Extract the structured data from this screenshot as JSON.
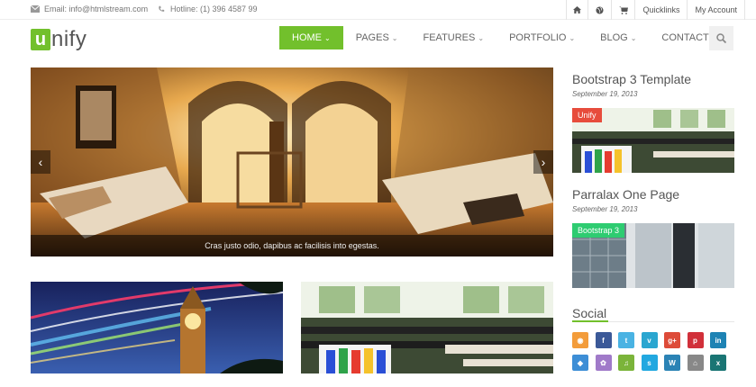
{
  "topbar": {
    "email": "Email: info@htmlstream.com",
    "hotline": "Hotline: (1) 396 4587 99",
    "quicklinks": "Quicklinks",
    "account": "My Account"
  },
  "logo": {
    "letter": "u",
    "text": "nify"
  },
  "nav": {
    "home": "HOME",
    "pages": "PAGES",
    "features": "FEATURES",
    "portfolio": "PORTFOLIO",
    "blog": "BLOG",
    "contacts": "CONTACTS"
  },
  "slider": {
    "caption": "Cras justo odio, dapibus ac facilisis into egestas.",
    "prev": "‹",
    "next": "›"
  },
  "sidebar": {
    "posts": [
      {
        "title": "Bootstrap 3 Template",
        "date": "September 19, 2013",
        "tag": "Unify",
        "tag_color": "#e74c3c"
      },
      {
        "title": "Parralax One Page",
        "date": "September 19, 2013",
        "tag": "Bootstrap 3",
        "tag_color": "#2ecc71"
      }
    ],
    "social_title": "Social",
    "social_icons": [
      {
        "name": "rss",
        "glyph": "◉",
        "color": "#f39c3a"
      },
      {
        "name": "facebook",
        "glyph": "f",
        "color": "#3b5998"
      },
      {
        "name": "twitter",
        "glyph": "t",
        "color": "#4ab3e3"
      },
      {
        "name": "vimeo",
        "glyph": "v",
        "color": "#2aa6d0"
      },
      {
        "name": "google-plus",
        "glyph": "g+",
        "color": "#dd4b39"
      },
      {
        "name": "pinterest",
        "glyph": "p",
        "color": "#d1303a"
      },
      {
        "name": "linkedin",
        "glyph": "in",
        "color": "#1e83b4"
      },
      {
        "name": "dropbox",
        "glyph": "◆",
        "color": "#3d8ed6"
      },
      {
        "name": "picasa",
        "glyph": "✿",
        "color": "#a07ac9"
      },
      {
        "name": "spotify",
        "glyph": "♫",
        "color": "#7bb43a"
      },
      {
        "name": "skype",
        "glyph": "s",
        "color": "#22a8e0"
      },
      {
        "name": "wordpress",
        "glyph": "W",
        "color": "#2b83b5"
      },
      {
        "name": "github",
        "glyph": "⌂",
        "color": "#888888"
      },
      {
        "name": "xing",
        "glyph": "x",
        "color": "#1a7574"
      }
    ]
  },
  "colors": {
    "accent": "#72c02c"
  }
}
